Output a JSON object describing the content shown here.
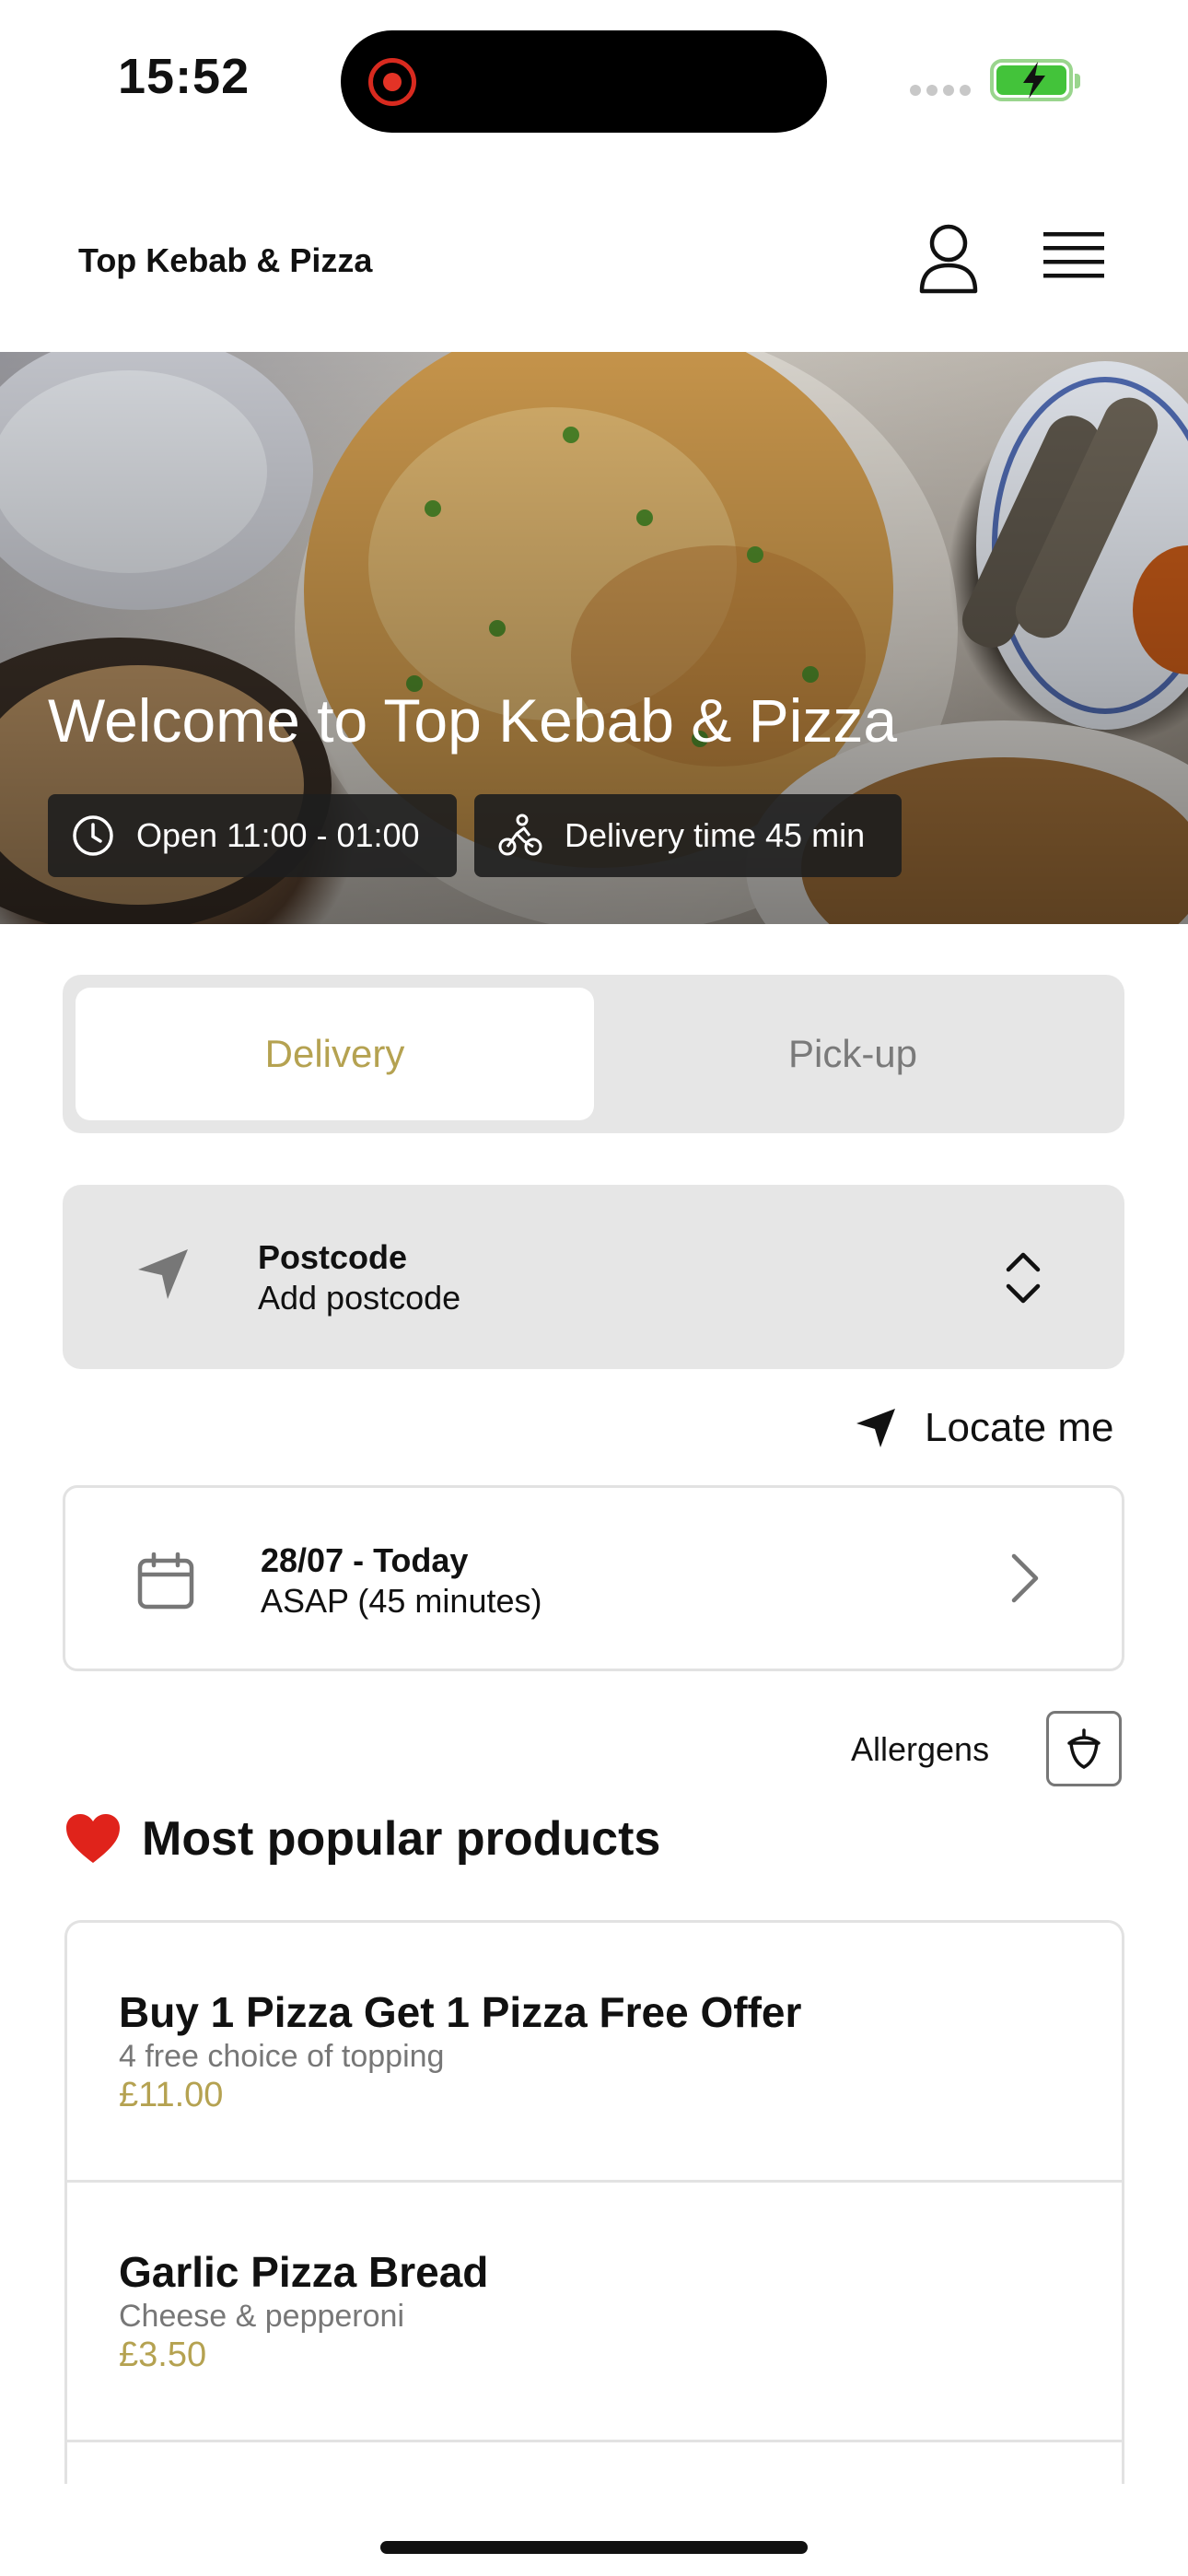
{
  "status_bar": {
    "time": "15:52"
  },
  "header": {
    "brand": "Top Kebab & Pizza"
  },
  "hero": {
    "title": "Welcome to Top Kebab & Pizza",
    "open_hours": "Open 11:00 - 01:00",
    "delivery_time": "Delivery time 45 min"
  },
  "mode_toggle": {
    "options": [
      "Delivery",
      "Pick-up"
    ],
    "selected": "Delivery"
  },
  "postcode": {
    "title": "Postcode",
    "placeholder": "Add postcode"
  },
  "locate_me": "Locate me",
  "schedule": {
    "date": "28/07 - Today",
    "time": "ASAP (45 minutes)"
  },
  "allergens_label": "Allergens",
  "popular": {
    "title": "Most popular products",
    "emoji": "❤️",
    "products": [
      {
        "name": "Buy 1 Pizza Get 1 Pizza Free Offer",
        "description": "4 free choice of topping",
        "price": "£11.00"
      },
      {
        "name": "Garlic Pizza Bread",
        "description": "Cheese & pepperoni",
        "price": "£3.50"
      }
    ]
  },
  "colors": {
    "accent": "#b5a251",
    "panel": "#e6e6e6",
    "chip": "#1e1e1e",
    "battery": "#43c33a",
    "record": "#e33326"
  },
  "icons": [
    "record-icon",
    "signal-icon",
    "battery-icon",
    "user-icon",
    "menu-icon",
    "clock-icon",
    "bike-icon",
    "location-arrow-icon",
    "chevron-updown-icon",
    "calendar-icon",
    "chevron-right-icon",
    "acorn-icon",
    "heart-icon"
  ]
}
